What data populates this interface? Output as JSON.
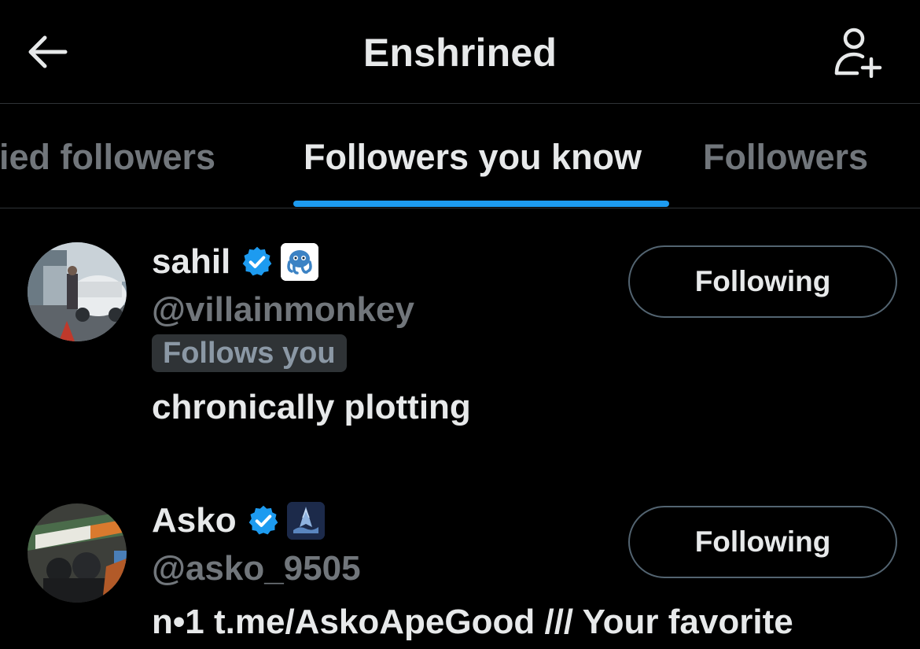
{
  "header": {
    "title": "Enshrined",
    "back_icon": "arrow-left-icon",
    "add_user_icon": "add-user-icon"
  },
  "tabs": [
    {
      "label": "fied followers",
      "active": false
    },
    {
      "label": "Followers you know",
      "active": true
    },
    {
      "label": "Followers",
      "active": false
    }
  ],
  "users": [
    {
      "name": "sahil",
      "handle": "@villainmonkey",
      "verified": true,
      "affiliate_icon": "octopus-badge-icon",
      "follows_you": "Follows you",
      "bio": "chronically plotting",
      "button": "Following"
    },
    {
      "name": "Asko",
      "handle": "@asko_9505",
      "verified": true,
      "affiliate_icon": "shark-badge-icon",
      "bio": "n•1 t.me/AskoApeGood /// Your favorite",
      "button": "Following"
    }
  ],
  "colors": {
    "background": "#000000",
    "text_primary": "#e7e9ea",
    "text_secondary": "#71767b",
    "accent": "#1d9bf0",
    "border": "#2f3336"
  }
}
